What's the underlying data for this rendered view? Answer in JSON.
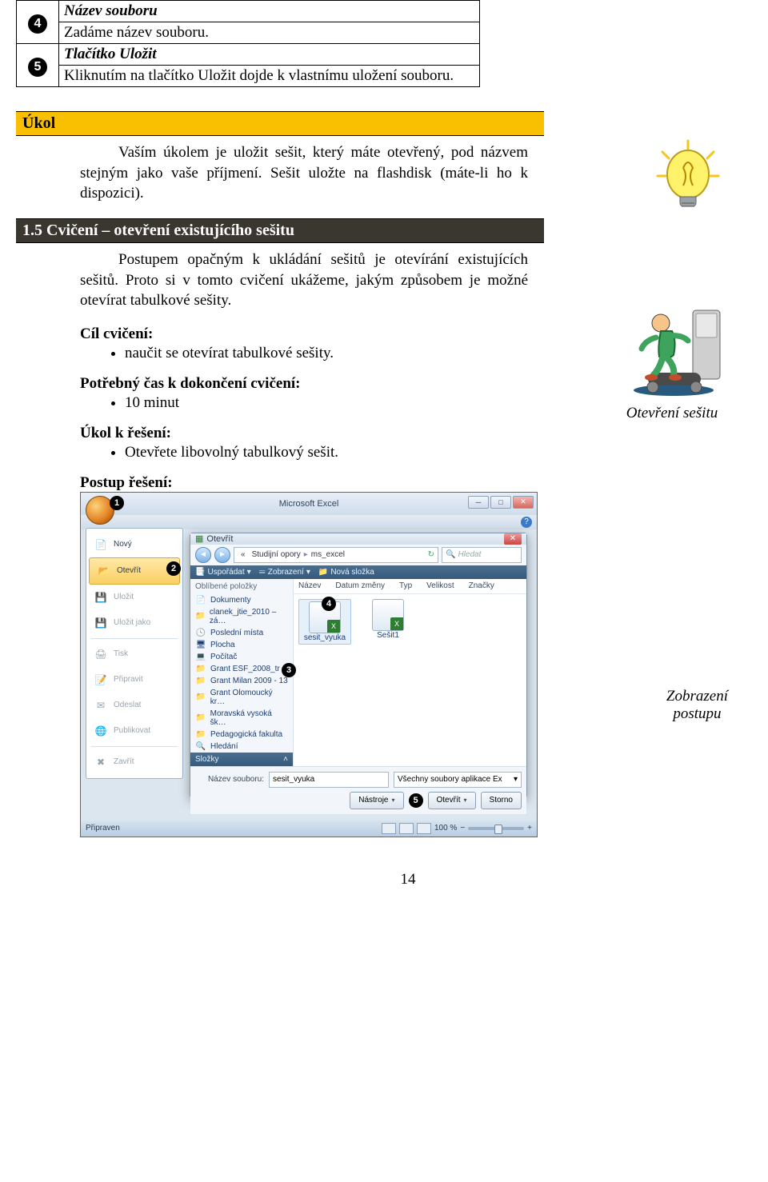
{
  "top_table": {
    "row4": {
      "num": "4",
      "title": "Název souboru",
      "text": "Zadáme název souboru."
    },
    "row5": {
      "num": "5",
      "title": "Tlačítko Uložit",
      "text": "Kliknutím na tlačítko Uložit dojde k vlastnímu uložení souboru."
    }
  },
  "task": {
    "heading": "Úkol",
    "text": "Vaším úkolem je uložit sešit, který máte otevřený, pod názvem stejným jako vaše příjmení. Sešit uložte na flashdisk (máte-li ho k dispozici)."
  },
  "ex": {
    "heading": "1.5 Cvičení – otevření existujícího sešitu",
    "text": "Postupem opačným k ukládání sešitů je otevírání existujících sešitů. Proto si v tomto cvičení ukážeme, jakým způsobem je možné otevírat tabulkové sešity."
  },
  "goal": {
    "label": "Cíl cvičení:",
    "item": "naučit se otevírat tabulkové sešity."
  },
  "time": {
    "label": "Potřebný čas k dokončení cvičení:",
    "item": "10 minut"
  },
  "solve": {
    "label": "Úkol k řešení:",
    "item": "Otevřete libovolný tabulkový sešit."
  },
  "steps_label": "Postup řešení:",
  "side": {
    "open": "Otevření sešitu",
    "view_l1": "Zobrazení",
    "view_l2": "postupu"
  },
  "fig": {
    "excel_title": "Microsoft Excel",
    "menu": {
      "novy": "Nový",
      "otevrit": "Otevřít",
      "ulozit": "Uložit",
      "ulozit_jako": "Uložit jako",
      "tisk": "Tisk",
      "pripravit": "Připravit",
      "odeslat": "Odeslat",
      "publikovat": "Publikovat",
      "zavrit": "Zavřít"
    },
    "dlg": {
      "title": "Otevřít",
      "crumb_a": "Studijní opory",
      "crumb_b": "ms_excel",
      "search_ph": "Hledat",
      "tb_org": "Uspořádat",
      "tb_view": "Zobrazení",
      "tb_new": "Nová složka",
      "fav_header": "Oblíbené položky",
      "favs": [
        "Dokumenty",
        "clanek_jtie_2010 – zá…",
        "Poslední místa",
        "Plocha",
        "Počítač",
        "Grant ESF_2008_tr",
        "Grant Milan 2009 - 13",
        "Grant Olomoucký kr…",
        "Moravská vysoká šk…",
        "Pedagogická fakulta",
        "Hledání"
      ],
      "folders_label": "Složky",
      "cols": [
        "Název",
        "Datum změny",
        "Typ",
        "Velikost",
        "Značky"
      ],
      "file1": "sesit_vyuka",
      "file2": "Sešit1",
      "fname_label": "Název souboru:",
      "fname_value": "sesit_vyuka",
      "filter": "Všechny soubory aplikace Ex",
      "tools": "Nástroje",
      "open_btn": "Otevřít",
      "cancel_btn": "Storno"
    },
    "status": {
      "ready": "Připraven",
      "zoom": "100 %"
    },
    "callouts": {
      "c1": "1",
      "c2": "2",
      "c3": "3",
      "c4": "4",
      "c5": "5"
    }
  },
  "page_num": "14"
}
